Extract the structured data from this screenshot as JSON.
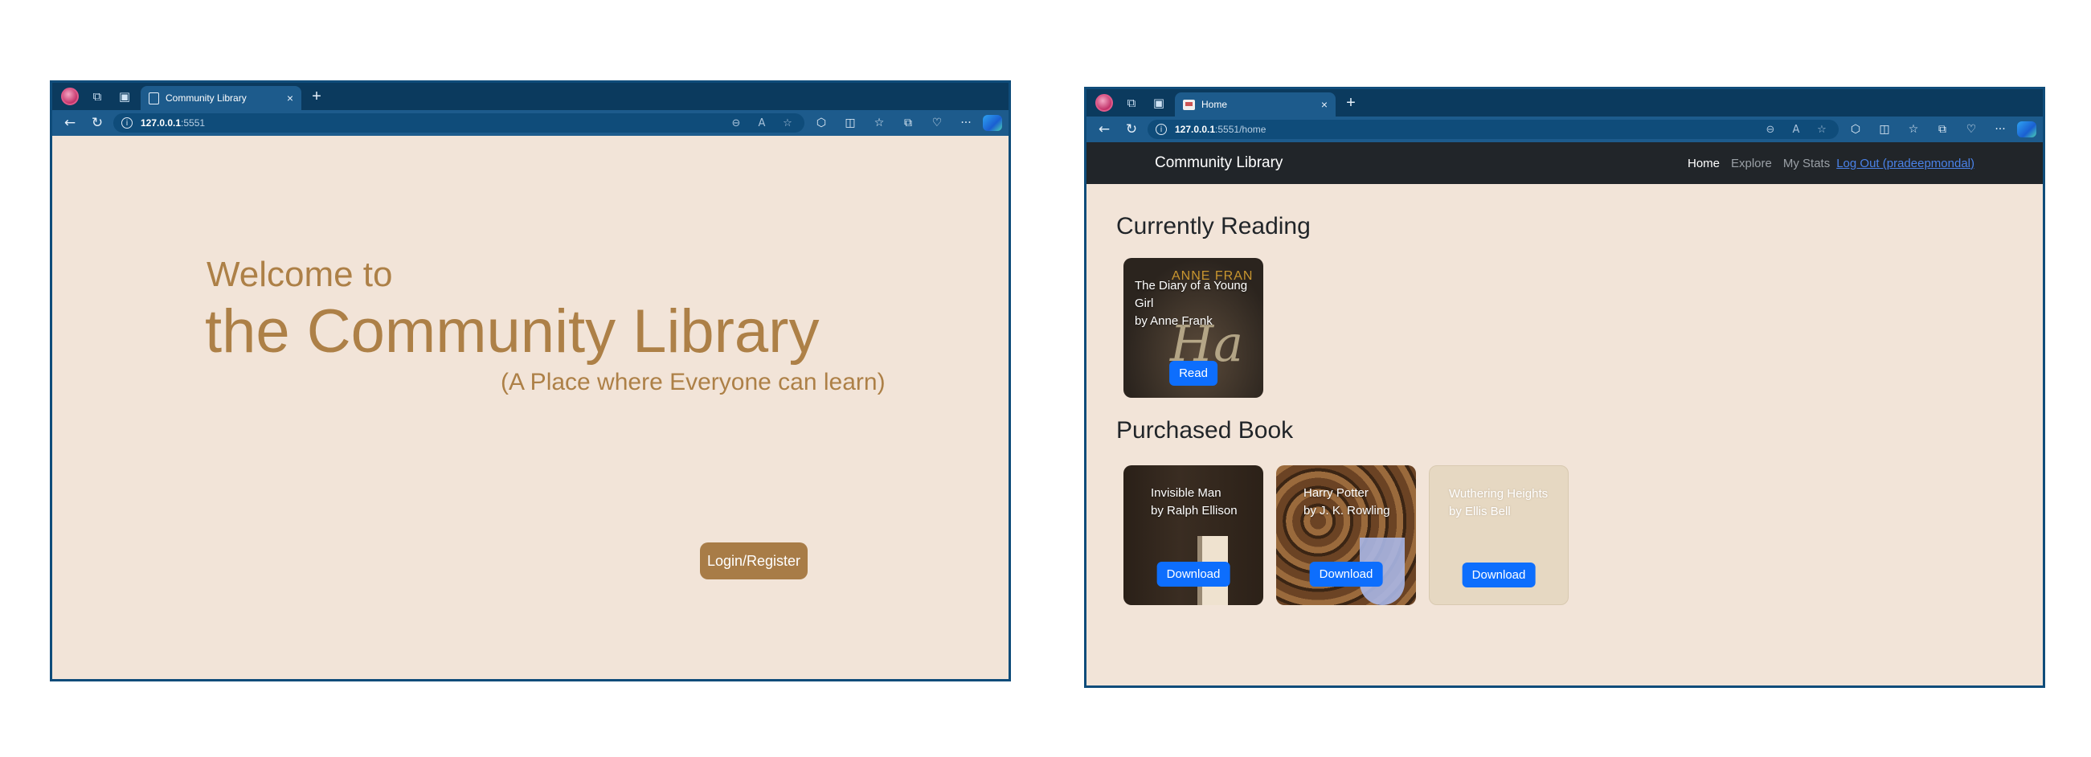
{
  "window1": {
    "tab_title": "Community Library",
    "url_host": "127.0.0.1",
    "url_path": ":5551",
    "page": {
      "welcome_small": "Welcome to",
      "welcome_large": "the Community Library",
      "tagline": "(A Place where Everyone can learn)",
      "login_button": "Login/Register"
    }
  },
  "window2": {
    "tab_title": "Home",
    "url_host": "127.0.0.1",
    "url_path": ":5551/home",
    "navbar": {
      "brand": "Community Library",
      "links": [
        "Home",
        "Explore",
        "My Stats"
      ],
      "logout": "Log Out (pradeepmondal)"
    },
    "currently_reading": {
      "title": "Currently Reading",
      "books": [
        {
          "title": "The Diary of a Young Girl",
          "author": "by Anne Frank",
          "action": "Read",
          "cover_text": "ANNE FRAN",
          "cover_art": "Ha"
        }
      ]
    },
    "purchased": {
      "title": "Purchased Book",
      "books": [
        {
          "title": "Invisible Man",
          "author": "by Ralph Ellison",
          "action": "Download"
        },
        {
          "title": "Harry Potter",
          "author": "by J. K. Rowling",
          "action": "Download"
        },
        {
          "title": "Wuthering Heights",
          "author": "by Ellis Bell",
          "action": "Download"
        }
      ]
    }
  },
  "icons": {
    "new_tab": "+",
    "close_tab": "×",
    "back": "←",
    "reload": "↻",
    "info": "i",
    "more": "···"
  }
}
